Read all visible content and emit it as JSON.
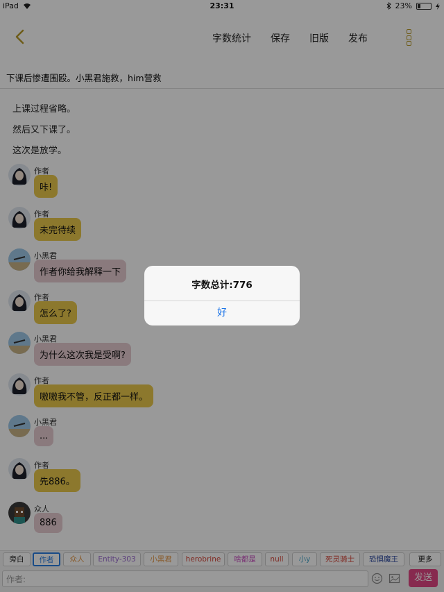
{
  "status_bar": {
    "device": "iPad",
    "time": "23:31",
    "battery": "23%",
    "battery_level": 0.23
  },
  "nav": {
    "word_count": "字数统计",
    "save": "保存",
    "old_version": "旧版",
    "publish": "发布"
  },
  "topic": "下课后惨遭围殴。小黑君施救，him营救",
  "narration": [
    "上课过程省略。",
    "然后又下课了。",
    "这次是放学。"
  ],
  "messages": [
    {
      "name": "作者",
      "text": "咔!",
      "style": "y",
      "avatar": "anime-girl-avatar"
    },
    {
      "name": "作者",
      "text": "未完待续",
      "style": "y",
      "avatar": "anime-girl-avatar"
    },
    {
      "name": "小黑君",
      "text": "作者你给我解释一下",
      "style": "p",
      "avatar": "blue-sky-avatar"
    },
    {
      "name": "作者",
      "text": "怎么了?",
      "style": "y",
      "avatar": "anime-girl-avatar"
    },
    {
      "name": "小黑君",
      "text": "为什么这次我是受啊?",
      "style": "p",
      "avatar": "blue-sky-avatar"
    },
    {
      "name": "作者",
      "text": "嗷嗷我不管，反正都一样。",
      "style": "y",
      "avatar": "anime-girl-avatar"
    },
    {
      "name": "小黑君",
      "text": "...",
      "style": "p",
      "avatar": "blue-sky-avatar"
    },
    {
      "name": "作者",
      "text": "先886。",
      "style": "y",
      "avatar": "anime-girl-avatar"
    },
    {
      "name": "众人",
      "text": "886",
      "style": "p",
      "avatar": "minecraft-avatar"
    }
  ],
  "characters": [
    {
      "label": "旁白",
      "color": "#222222"
    },
    {
      "label": "作者",
      "color": "#2a7de1"
    },
    {
      "label": "众人",
      "color": "#e59a4a"
    },
    {
      "label": "Entity-303",
      "color": "#9b6bd0"
    },
    {
      "label": "小黑君",
      "color": "#e59a4a"
    },
    {
      "label": "herobrine",
      "color": "#d6463a"
    },
    {
      "label": "啥都是",
      "color": "#c84fc0"
    },
    {
      "label": "null",
      "color": "#d6463a"
    },
    {
      "label": "小y",
      "color": "#4aa6c8"
    },
    {
      "label": "死灵骑士",
      "color": "#d6463a"
    },
    {
      "label": "恐惧魔王",
      "color": "#2d4aa0"
    }
  ],
  "more_label": "更多",
  "input_placeholder": "作者:",
  "send_label": "发送",
  "alert": {
    "title": "字数总计:776",
    "button": "好"
  },
  "colors": {
    "accent_yellow": "#e9c94c",
    "bubble_pink": "#e6cbd0",
    "send_pink": "#e24784",
    "alert_blue": "#1a73e8"
  }
}
